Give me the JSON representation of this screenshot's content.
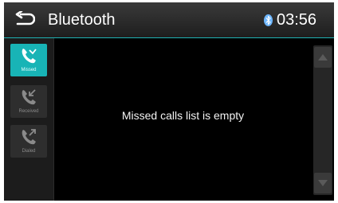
{
  "header": {
    "title": "Bluetooth",
    "time": "03:56",
    "back_icon": "back-arrow-icon",
    "status_icon": "bluetooth-icon"
  },
  "sidebar": {
    "tabs": [
      {
        "label": "Missed",
        "icon": "missed-call-icon",
        "active": true
      },
      {
        "label": "Received",
        "icon": "received-call-icon",
        "active": false
      },
      {
        "label": "Dialed",
        "icon": "dialed-call-icon",
        "active": false
      }
    ]
  },
  "main": {
    "empty_message": "Missed calls list is empty"
  },
  "colors": {
    "accent": "#18b4b6",
    "background": "#000000",
    "header": "#2a2a2a",
    "text": "#ffffff"
  }
}
